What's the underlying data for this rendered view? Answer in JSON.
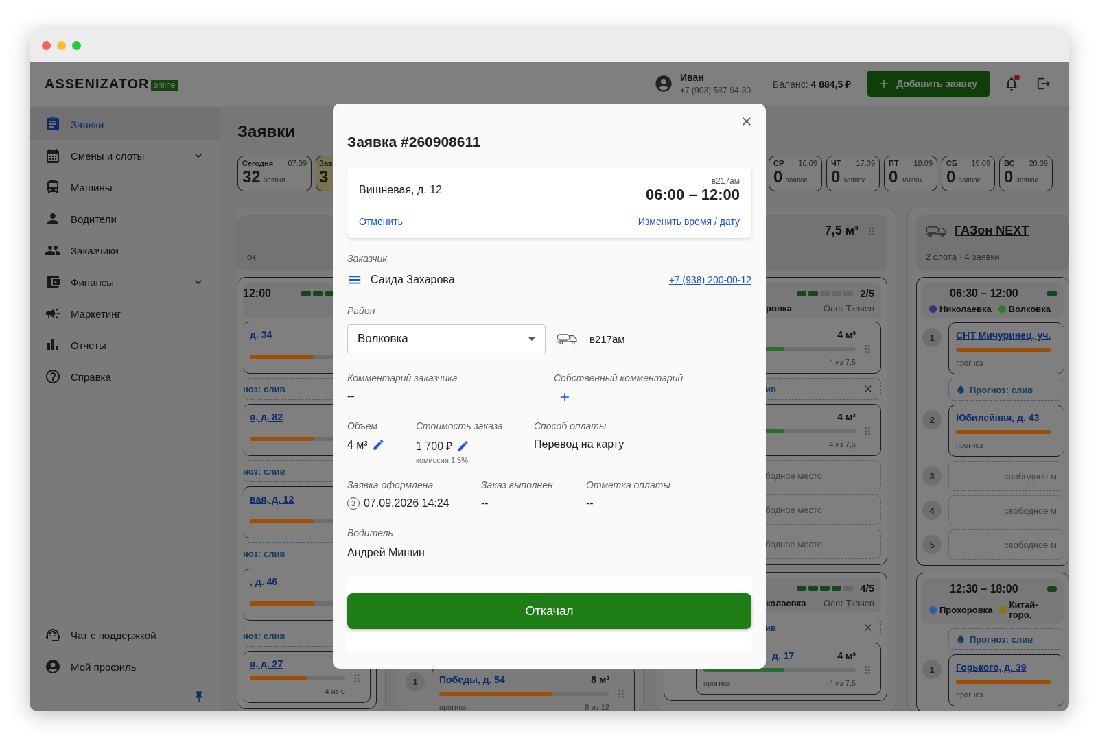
{
  "window": {
    "controls": [
      {
        "color": "#ff5f57"
      },
      {
        "color": "#febc2e"
      },
      {
        "color": "#28c840"
      }
    ]
  },
  "header": {
    "logo": "ASSENIZATOR",
    "logo_tag": "online",
    "user": {
      "name": "Иван",
      "phone": "+7 (903) 587-94-30"
    },
    "balance_label": "Баланс:",
    "balance": "4 884,5 ₽",
    "add_button": "Добавить заявку",
    "notifications": {
      "unread": true
    }
  },
  "sidebar": {
    "items": [
      {
        "label": "Заявки",
        "selected": true,
        "expandable": false
      },
      {
        "label": "Смены и слоты",
        "selected": false,
        "expandable": true
      },
      {
        "label": "Машины",
        "selected": false,
        "expandable": false
      },
      {
        "label": "Водители",
        "selected": false,
        "expandable": false
      },
      {
        "label": "Заказчики",
        "selected": false,
        "expandable": false
      },
      {
        "label": "Финансы",
        "selected": false,
        "expandable": true
      },
      {
        "label": "Маркетинг",
        "selected": false,
        "expandable": false
      },
      {
        "label": "Отчеты",
        "selected": false,
        "expandable": false
      },
      {
        "label": "Справка",
        "selected": false,
        "expandable": false
      }
    ],
    "footer_items": [
      {
        "label": "Чат с поддержкой"
      },
      {
        "label": "Мой профиль"
      }
    ]
  },
  "page": {
    "title": "Заявки"
  },
  "days": {
    "left": [
      {
        "label": "Сегодня",
        "date": "07.09",
        "count": "32",
        "unit": "заявки",
        "selected": false
      },
      {
        "label": "Зав",
        "count": "3",
        "selected": true
      }
    ],
    "right": [
      {
        "label": "СР",
        "date": "16.09",
        "count": "0",
        "unit": "заявок",
        "selected": false
      },
      {
        "label": "ЧТ",
        "date": "17.09",
        "count": "0",
        "unit": "заявок",
        "selected": false
      },
      {
        "label": "ПТ",
        "date": "18.09",
        "count": "0",
        "unit": "заявок",
        "selected": false
      },
      {
        "label": "СБ",
        "date": "19.09",
        "count": "0",
        "unit": "заявок",
        "selected": false
      },
      {
        "label": "ВС",
        "date": "20.09",
        "count": "0",
        "unit": "заявок",
        "selected": false
      }
    ]
  },
  "board": {
    "columns": [
      {
        "kind": "left-cut",
        "header": {
          "note": "ок"
        },
        "slots": [
          {
            "time": "12:00",
            "segments": [
              {
                "filled": true
              },
              {
                "filled": true
              },
              {
                "filled": true
              }
            ],
            "rows": [
              {
                "kind": "order",
                "address": "д. 34",
                "bar": {
                  "level": 0.6,
                  "color": "#9c4f05"
                }
              },
              {
                "kind": "forecast",
                "text": "ноз: слив",
                "closable": false
              },
              {
                "kind": "order",
                "address": "я, д. 82",
                "bar": {
                  "level": 0.6,
                  "color": "#9c4f05"
                }
              },
              {
                "kind": "forecast",
                "text": "ноз: слив",
                "closable": false
              },
              {
                "kind": "order",
                "address": "вая, д. 12",
                "bar": {
                  "level": 0.6,
                  "color": "#9c4f05"
                }
              },
              {
                "kind": "forecast",
                "text": "ноз: слив",
                "closable": false
              },
              {
                "kind": "order",
                "address": ", д. 46",
                "bar": {
                  "level": 0.6,
                  "color": "#9c4f05"
                }
              },
              {
                "kind": "forecast",
                "text": "ноз: слив",
                "closable": false
              },
              {
                "kind": "order",
                "address": "я, д. 27",
                "bar": {
                  "level": 0.6,
                  "color": "#9c4f05"
                },
                "count": "4 из 6"
              }
            ]
          }
        ]
      },
      {
        "kind": "bottom",
        "slots": [
          {
            "rows": [
              {
                "kind": "order",
                "number": "1",
                "address": "Победы, д. 54",
                "volume": "8 м³",
                "bar": {
                  "level": 0.67,
                  "color": "#9c4f05"
                },
                "note": "прогноз",
                "count": "8 из 12"
              }
            ]
          }
        ]
      },
      {
        "kind": "mid",
        "header": {
          "volume": "7,5 м³"
        },
        "slots": [
          {
            "segments": [
              {
                "filled": true
              },
              {
                "filled": true
              },
              {
                "filled": false
              },
              {
                "filled": false
              },
              {
                "filled": false
              }
            ],
            "ratio": "2/5",
            "districts": [
              {
                "name": "ровка"
              }
            ],
            "driver": "Олег Ткачев",
            "rows": [
              {
                "kind": "order",
                "volume": "4 м³",
                "bar": {
                  "level": 0.53,
                  "color": "#2a6e2f"
                },
                "count": "4 из 7,5"
              },
              {
                "kind": "forecast",
                "text": "ив",
                "closable": true
              },
              {
                "kind": "order",
                "volume": "4 м³",
                "bar": {
                  "level": 0.53,
                  "color": "#2a6e2f"
                },
                "count": "4 из 7,5"
              },
              {
                "kind": "free",
                "text": "бодное место"
              },
              {
                "kind": "free",
                "text": "бодное место"
              },
              {
                "kind": "free",
                "text": "бодное место"
              }
            ]
          },
          {
            "segments": [
              {
                "filled": true
              },
              {
                "filled": true
              },
              {
                "filled": true
              },
              {
                "filled": true
              },
              {
                "filled": false
              }
            ],
            "ratio": "4/5",
            "districts": [
              {
                "name": "колаевка"
              }
            ],
            "driver": "Олег Ткачев",
            "rows": [
              {
                "kind": "forecast",
                "text": "ив",
                "closable": true
              },
              {
                "kind": "order",
                "address": "д. 17",
                "volume": "4 м³",
                "bar": {
                  "level": 0.53,
                  "color": "#2a6e2f"
                },
                "note": "прогноз",
                "count": "4 из 7,5"
              }
            ]
          }
        ]
      },
      {
        "kind": "right-cut",
        "header": {
          "vehicle": "ГАЗон NEXT",
          "summary": "2 слота · 4 заявки"
        },
        "slots": [
          {
            "time": "06:30 – 12:00",
            "segments": [
              {
                "filled": true
              }
            ],
            "districts": [
              {
                "name": "Николаевка",
                "color": "#35307f"
              },
              {
                "name": "Волковка",
                "color": "#2a7a30"
              }
            ],
            "rows": [
              {
                "kind": "order",
                "number": "1",
                "address": "СНТ Мичуринец, уч.",
                "bar": {
                  "level": 1,
                  "color": "#9c4f05"
                },
                "note": "прогноз"
              },
              {
                "kind": "forecast",
                "text": "Прогноз: слив",
                "closable": false
              },
              {
                "kind": "order",
                "number": "2",
                "address": "Юбилейная, д. 43",
                "bar": {
                  "level": 1,
                  "color": "#9c4f05"
                },
                "note": "прогноз"
              },
              {
                "kind": "free",
                "number": "3",
                "text": "свободное м"
              },
              {
                "kind": "free",
                "number": "4",
                "text": "свободное м"
              },
              {
                "kind": "free",
                "number": "5",
                "text": "свободное м"
              }
            ]
          },
          {
            "time": "12:30 – 18:00",
            "segments": [
              {
                "filled": true
              }
            ],
            "districts": [
              {
                "name": "Прохоровка",
                "color": "#2a5aa8"
              },
              {
                "name": "Китай-горо,",
                "color": "#8a7410"
              }
            ],
            "rows": [
              {
                "kind": "forecast",
                "text": "Прогноз: слив",
                "closable": false
              },
              {
                "kind": "order",
                "number": "1",
                "address": "Горького, д. 39",
                "bar": {
                  "level": 1,
                  "color": "#9c4f05"
                },
                "note": "прогноз"
              }
            ]
          }
        ]
      }
    ]
  },
  "modal": {
    "title": "Заявка #260908611",
    "summary": {
      "address": "Вишневая, д. 12",
      "plate": "в217ам",
      "time": "06:00 – 12:00",
      "cancel_link": "Отменить",
      "reschedule_link": "Изменить время / дату"
    },
    "customer": {
      "label": "Заказчик",
      "name": "Саида Захарова",
      "phone": "+7 (938) 200-00-12"
    },
    "district": {
      "label": "Район",
      "value": "Волковка",
      "vehicle": "в217ам"
    },
    "comments": [
      {
        "kind": "text",
        "label": "Комментарий заказчика",
        "value": "--"
      },
      {
        "kind": "add",
        "label": "Собственный комментарий"
      }
    ],
    "details": [
      {
        "label": "Объем",
        "value": "4 м³",
        "editable": true
      },
      {
        "label": "Стоимость заказа",
        "value": "1 700 ₽",
        "editable": true,
        "note": "комиссия 1,5%"
      },
      {
        "label": "Способ оплаты",
        "value": "Перевод на карту",
        "editable": false
      }
    ],
    "timeline": [
      {
        "label": "Заявка оформлена",
        "value": "07.09.2026 14:24",
        "badge": "3"
      },
      {
        "label": "Заказ выполнен",
        "value": "--"
      },
      {
        "label": "Отметка оплаты",
        "value": "--"
      }
    ],
    "driver": {
      "label": "Водитель",
      "name": "Андрей Мишин"
    },
    "action": "Откачал"
  }
}
